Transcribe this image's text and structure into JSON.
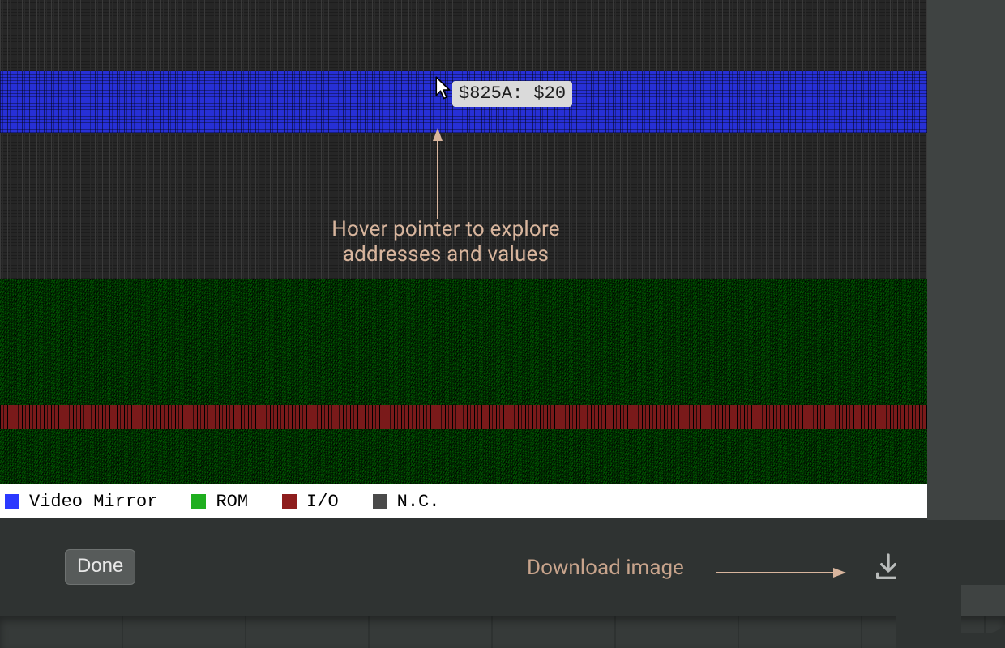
{
  "tooltip": {
    "text": "$825A: $20"
  },
  "annotation": {
    "line1": "Hover pointer to explore",
    "line2": "addresses and values"
  },
  "legend": {
    "items": [
      {
        "label": "Video Mirror",
        "color": "#2b39ff"
      },
      {
        "label": "ROM",
        "color": "#1fae1f"
      },
      {
        "label": "I/O",
        "color": "#8e1d1d"
      },
      {
        "label": "N.C.",
        "color": "#4a4a4a"
      }
    ]
  },
  "toolbar": {
    "done_label": "Done",
    "download_label": "Download image"
  },
  "icons": {
    "cursor": "cursor-arrow-icon",
    "download": "download-icon"
  }
}
